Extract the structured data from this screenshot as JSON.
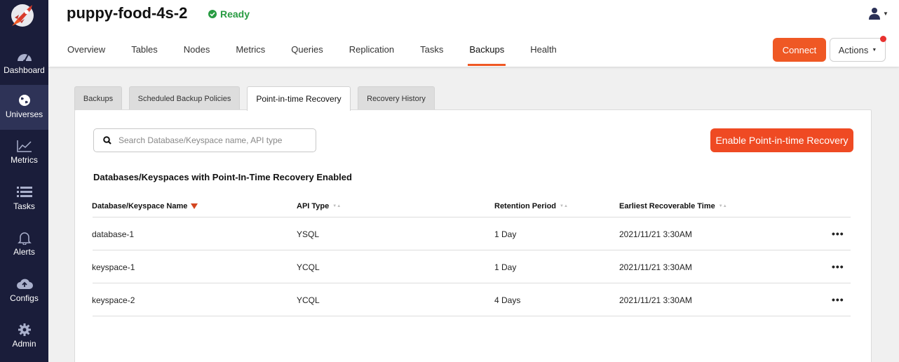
{
  "sidebar": {
    "logo_icon": "rocket-logo-icon",
    "items": [
      {
        "label": "Dashboard",
        "icon": "gauge-icon"
      },
      {
        "label": "Universes",
        "icon": "globe-icon"
      },
      {
        "label": "Metrics",
        "icon": "line-chart-icon"
      },
      {
        "label": "Tasks",
        "icon": "list-icon"
      },
      {
        "label": "Alerts",
        "icon": "bell-icon"
      },
      {
        "label": "Configs",
        "icon": "cloud-upload-icon"
      },
      {
        "label": "Admin",
        "icon": "gear-icon"
      }
    ],
    "active": "Universes"
  },
  "header": {
    "title": "puppy-food-4s-2",
    "status": "Ready",
    "status_color": "#289b42",
    "tabs": [
      "Overview",
      "Tables",
      "Nodes",
      "Metrics",
      "Queries",
      "Replication",
      "Tasks",
      "Backups",
      "Health"
    ],
    "active_tab": "Backups",
    "connect_label": "Connect",
    "actions_label": "Actions"
  },
  "subtabs": {
    "items": [
      "Backups",
      "Scheduled Backup Policies",
      "Point-in-time Recovery",
      "Recovery History"
    ],
    "active": "Point-in-time Recovery"
  },
  "pitr": {
    "search_placeholder": "Search Database/Keyspace name, API type",
    "enable_label": "Enable Point-in-time Recovery",
    "section_title": "Databases/Keyspaces with Point-In-Time Recovery Enabled",
    "columns": [
      "Database/Keyspace Name",
      "API Type",
      "Retention Period",
      "Earliest Recoverable Time"
    ],
    "rows": [
      {
        "name": "database-1",
        "api": "YSQL",
        "retention": "1 Day",
        "earliest": "2021/11/21 3:30AM"
      },
      {
        "name": "keyspace-1",
        "api": "YCQL",
        "retention": "1 Day",
        "earliest": "2021/11/21 3:30AM"
      },
      {
        "name": "keyspace-2",
        "api": "YCQL",
        "retention": "4 Days",
        "earliest": "2021/11/21 3:30AM"
      }
    ],
    "row_menu": "•••"
  },
  "colors": {
    "accent": "#ef5824",
    "sidebar_bg": "#1a1d3a",
    "sidebar_active": "#2e3357"
  }
}
